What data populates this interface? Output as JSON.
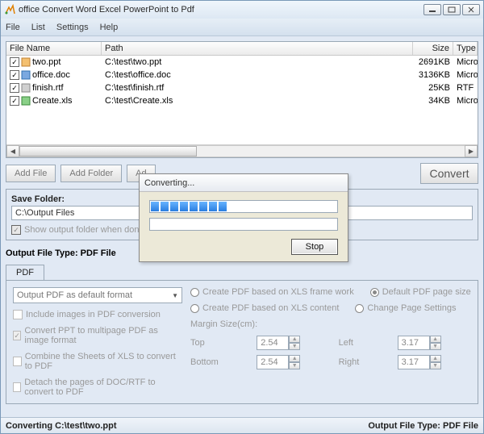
{
  "window": {
    "title": "office Convert Word Excel PowerPoint to Pdf"
  },
  "menu": {
    "file": "File",
    "list": "List",
    "settings": "Settings",
    "help": "Help"
  },
  "columns": {
    "filename": "File Name",
    "path": "Path",
    "size": "Size",
    "type": "Type"
  },
  "files": [
    {
      "name": "two.ppt",
      "path": "C:\\test\\two.ppt",
      "size": "2691KB",
      "type": "Micro"
    },
    {
      "name": "office.doc",
      "path": "C:\\test\\office.doc",
      "size": "3136KB",
      "type": "Micro"
    },
    {
      "name": "finish.rtf",
      "path": "C:\\test\\finish.rtf",
      "size": "25KB",
      "type": "RTF"
    },
    {
      "name": "Create.xls",
      "path": "C:\\test\\Create.xls",
      "size": "34KB",
      "type": "Micro"
    }
  ],
  "buttons": {
    "add_file": "Add File",
    "add_folder": "Add Folder",
    "add_trunc": "Ad",
    "convert": "Convert",
    "stop": "Stop"
  },
  "save": {
    "label": "Save Folder:",
    "value": "C:\\Output Files",
    "show_when_done": "Show output folder when done"
  },
  "outtype_label": "Output File Type:  PDF File",
  "tab": {
    "pdf": "PDF"
  },
  "pdfopts": {
    "default_format": "Output PDF as default format",
    "include_images": "Include images in PDF conversion",
    "convert_ppt": "Convert PPT to multipage PDF as image format",
    "combine_xls": "Combine the Sheets of XLS to convert to PDF",
    "detach_doc": "Detach the pages of DOC/RTF to convert to PDF"
  },
  "xlsopts": {
    "frame": "Create PDF based on XLS frame work",
    "content": "Create PDF based on XLS content",
    "default_size": "Default PDF page size",
    "change_settings": "Change Page Settings",
    "margin_label": "Margin Size(cm):",
    "top": "Top",
    "left": "Left",
    "bottom": "Bottom",
    "right": "Right",
    "v_top": "2.54",
    "v_left": "3.17",
    "v_bottom": "2.54",
    "v_right": "3.17"
  },
  "status": {
    "left": "Converting  C:\\test\\two.ppt",
    "right": "Output File Type:  PDF File"
  },
  "dialog": {
    "title": "Converting...",
    "progress_chunks": 8
  }
}
